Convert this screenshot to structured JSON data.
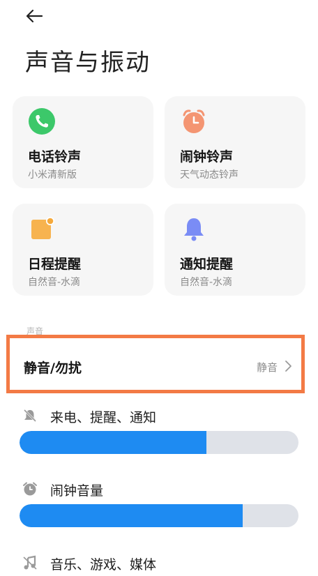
{
  "header": {
    "title": "声音与振动"
  },
  "cards": [
    {
      "name": "电话铃声",
      "sub": "小米清新版",
      "icon": "phone-icon",
      "color": "#3cc86a"
    },
    {
      "name": "闹钟铃声",
      "sub": "天气动态铃声",
      "icon": "alarm-clock-icon",
      "color": "#f49572"
    },
    {
      "name": "日程提醒",
      "sub": "自然音-水滴",
      "icon": "calendar-icon",
      "color": "#f7b34f"
    },
    {
      "name": "通知提醒",
      "sub": "自然音-水滴",
      "icon": "bell-icon",
      "color": "#7a8cf5"
    }
  ],
  "section": {
    "label": "声音"
  },
  "dnd": {
    "label": "静音/勿扰",
    "value": "静音"
  },
  "volumes": [
    {
      "label": "来电、提醒、通知",
      "icon": "bell-off-icon",
      "level": 0.67
    },
    {
      "label": "闹钟音量",
      "icon": "alarm-icon",
      "level": 0.8
    },
    {
      "label": "音乐、游戏、媒体",
      "icon": "music-icon",
      "level": null
    }
  ],
  "colors": {
    "accent": "#1e8bf2",
    "highlight_border": "#f37a45",
    "card_bg": "#f6f6f6"
  }
}
